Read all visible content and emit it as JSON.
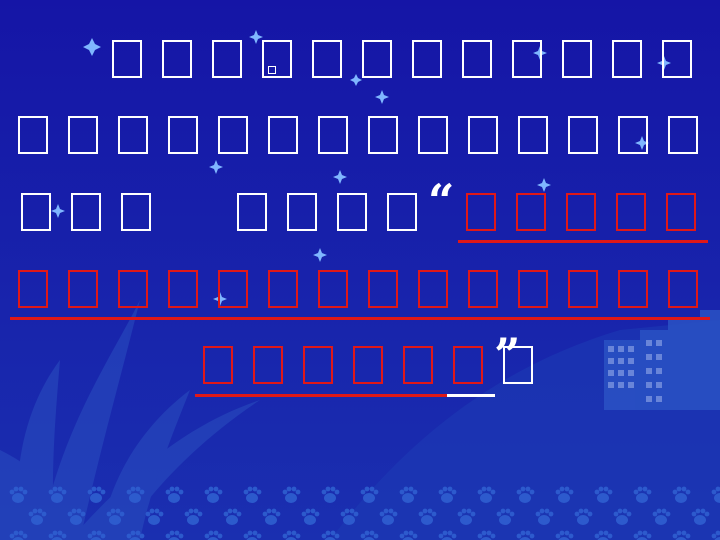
{
  "slide": {
    "colors": {
      "background": "#1515a6",
      "text_white": "#ffffff",
      "text_red": "#e01818",
      "underline_red": "#e01818",
      "underline_white": "#ffffff"
    },
    "quote_open": "“",
    "quote_close": "”",
    "lines": [
      {
        "white": 12,
        "red": 0
      },
      {
        "white": 14,
        "red": 0
      },
      {
        "white": 7,
        "red": 5
      },
      {
        "white": 0,
        "red": 14
      },
      {
        "white": 1,
        "red": 6
      }
    ]
  }
}
